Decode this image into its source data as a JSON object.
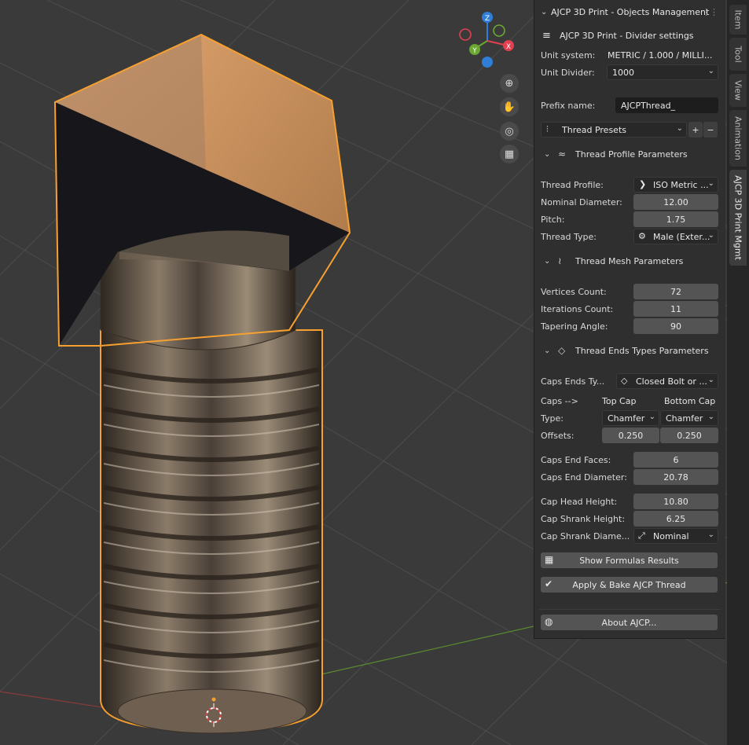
{
  "panel": {
    "header_title": "AJCP 3D Print - Objects Management",
    "divider_title": "AJCP 3D Print - Divider settings",
    "unit_system_label": "Unit system:",
    "unit_system_value": "METRIC / 1.000 / MILLI...",
    "unit_divider_label": "Unit Divider:",
    "unit_divider_value": "1000",
    "prefix_label": "Prefix name:",
    "prefix_value": "AJCPThread_",
    "presets_label": "Thread Presets",
    "add_symbol": "+",
    "remove_symbol": "−"
  },
  "profile_section": {
    "title": "Thread Profile Parameters",
    "thread_profile_label": "Thread Profile:",
    "thread_profile_value": "ISO Metric ...",
    "nominal_diameter_label": "Nominal Diameter:",
    "nominal_diameter_value": "12.00",
    "pitch_label": "Pitch:",
    "pitch_value": "1.75",
    "thread_type_label": "Thread Type:",
    "thread_type_value": "Male (Exter..."
  },
  "mesh_section": {
    "title": "Thread Mesh Parameters",
    "vertices_label": "Vertices Count:",
    "vertices_value": "72",
    "iterations_label": "Iterations Count:",
    "iterations_value": "11",
    "tapering_label": "Tapering Angle:",
    "tapering_value": "90"
  },
  "ends_section": {
    "title": "Thread Ends Types Parameters",
    "caps_ends_label": "Caps Ends Ty...",
    "caps_ends_value": "Closed Bolt or ...",
    "caps_label": "Caps -->",
    "top_cap_label": "Top Cap",
    "bottom_cap_label": "Bottom Cap",
    "type_label": "Type:",
    "top_type_value": "Chamfer",
    "bottom_type_value": "Chamfer",
    "offsets_label": "Offsets:",
    "top_offset_value": "0.250",
    "bottom_offset_value": "0.250",
    "end_faces_label": "Caps End Faces:",
    "end_faces_value": "6",
    "end_diameter_label": "Caps End Diameter:",
    "end_diameter_value": "20.78",
    "head_height_label": "Cap Head Height:",
    "head_height_value": "10.80",
    "shrank_height_label": "Cap Shrank Height:",
    "shrank_height_value": "6.25",
    "shrank_diameter_label": "Cap Shrank Diame...",
    "shrank_diameter_value": "Nominal"
  },
  "actions": {
    "show_formulas": "Show Formulas Results",
    "apply_bake": "Apply & Bake AJCP Thread",
    "about": "About AJCP..."
  },
  "tabs": [
    "Item",
    "Tool",
    "View",
    "Animation",
    "AJCP 3D Print Mgmt"
  ],
  "gizmo": {
    "z": "Z",
    "y": "Y",
    "x": "X"
  },
  "colors": {
    "selection_outline": "#f5a030",
    "axis_x": "#e0404f",
    "axis_y": "#6aa832",
    "axis_z": "#2f7fd8"
  }
}
